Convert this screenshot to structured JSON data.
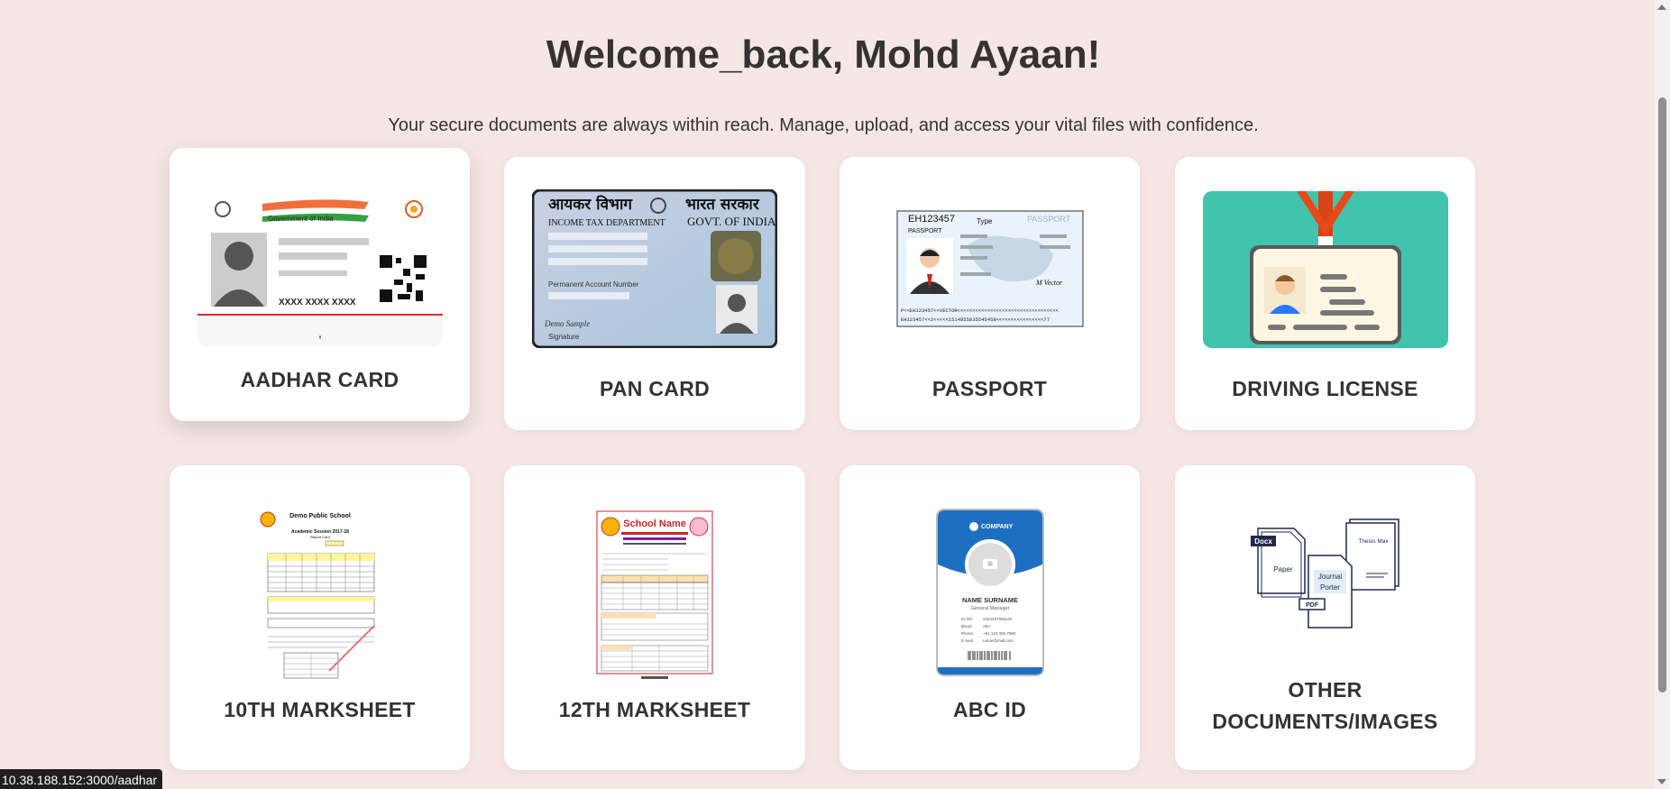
{
  "header": {
    "title": "Welcome_back, Mohd Ayaan!",
    "subtitle": "Your secure documents are always within reach. Manage, upload, and access your vital files with confidence."
  },
  "cards": [
    {
      "label": "AADHAR CARD",
      "icon": "aadhar-card-image"
    },
    {
      "label": "PAN CARD",
      "icon": "pan-card-image"
    },
    {
      "label": "PASSPORT",
      "icon": "passport-image"
    },
    {
      "label": "DRIVING LICENSE",
      "icon": "driving-license-image"
    },
    {
      "label": "10TH MARKSHEET",
      "icon": "marksheet-10th-image"
    },
    {
      "label": "12TH MARKSHEET",
      "icon": "marksheet-12th-image"
    },
    {
      "label": "ABC ID",
      "icon": "abc-id-image"
    },
    {
      "label": "OTHER DOCUMENTS/IMAGES",
      "icon": "other-documents-image"
    }
  ],
  "images": {
    "aadhar": {
      "gov_text": "Government of India",
      "number": "XXXX XXXX XXXX"
    },
    "pan": {
      "hindi_left": "आयकर विभाग",
      "hindi_right": "भारत सरकार",
      "dept": "INCOME TAX DEPARTMENT",
      "govt": "GOVT. OF INDIA",
      "pan_label": "Permanent Account Number",
      "sig_script": "Demo Sample",
      "sig_label": "Signature"
    },
    "passport": {
      "number": "EH123457",
      "label": "PASSPORT",
      "type": "Type",
      "watermark": "PASSPORT",
      "mrz1": "P<<EH123457<<VECTOR<<<<<<<<<<<<<<<<<<<<<<<<<<<<<<<<<<",
      "mrz2": "EH123457<<2<<<<<1514855835545458<<<<<<<<<<<<<<<<77",
      "signature": "M Vector"
    },
    "marksheet10": {
      "school": "Demo Public School",
      "session": "Academic Session 2017-18",
      "report": "Report Card"
    },
    "marksheet12": {
      "school": "School Name"
    },
    "abc": {
      "company": "COMPANY",
      "name": "NAME SURNAME",
      "role": "General Manager",
      "f1": "ID NO",
      "f2": "Blood",
      "f3": "Phone",
      "f4": "E-mail",
      "v1": "2324487965102",
      "v2": "AB+",
      "v3": "+91 123 456 7890",
      "v4": "name@mail.com"
    },
    "other": {
      "docx": "Docx",
      "paper": "Paper",
      "thesis": "Thesis Max",
      "journal": "Journal Porter",
      "pdf": "PDF"
    }
  },
  "status_bar": {
    "url": "10.38.188.152:3000/aadhar"
  },
  "colors": {
    "background": "#f7e6e6",
    "card": "#ffffff",
    "text": "#333333",
    "driving_license_bg": "#40c4ae"
  }
}
